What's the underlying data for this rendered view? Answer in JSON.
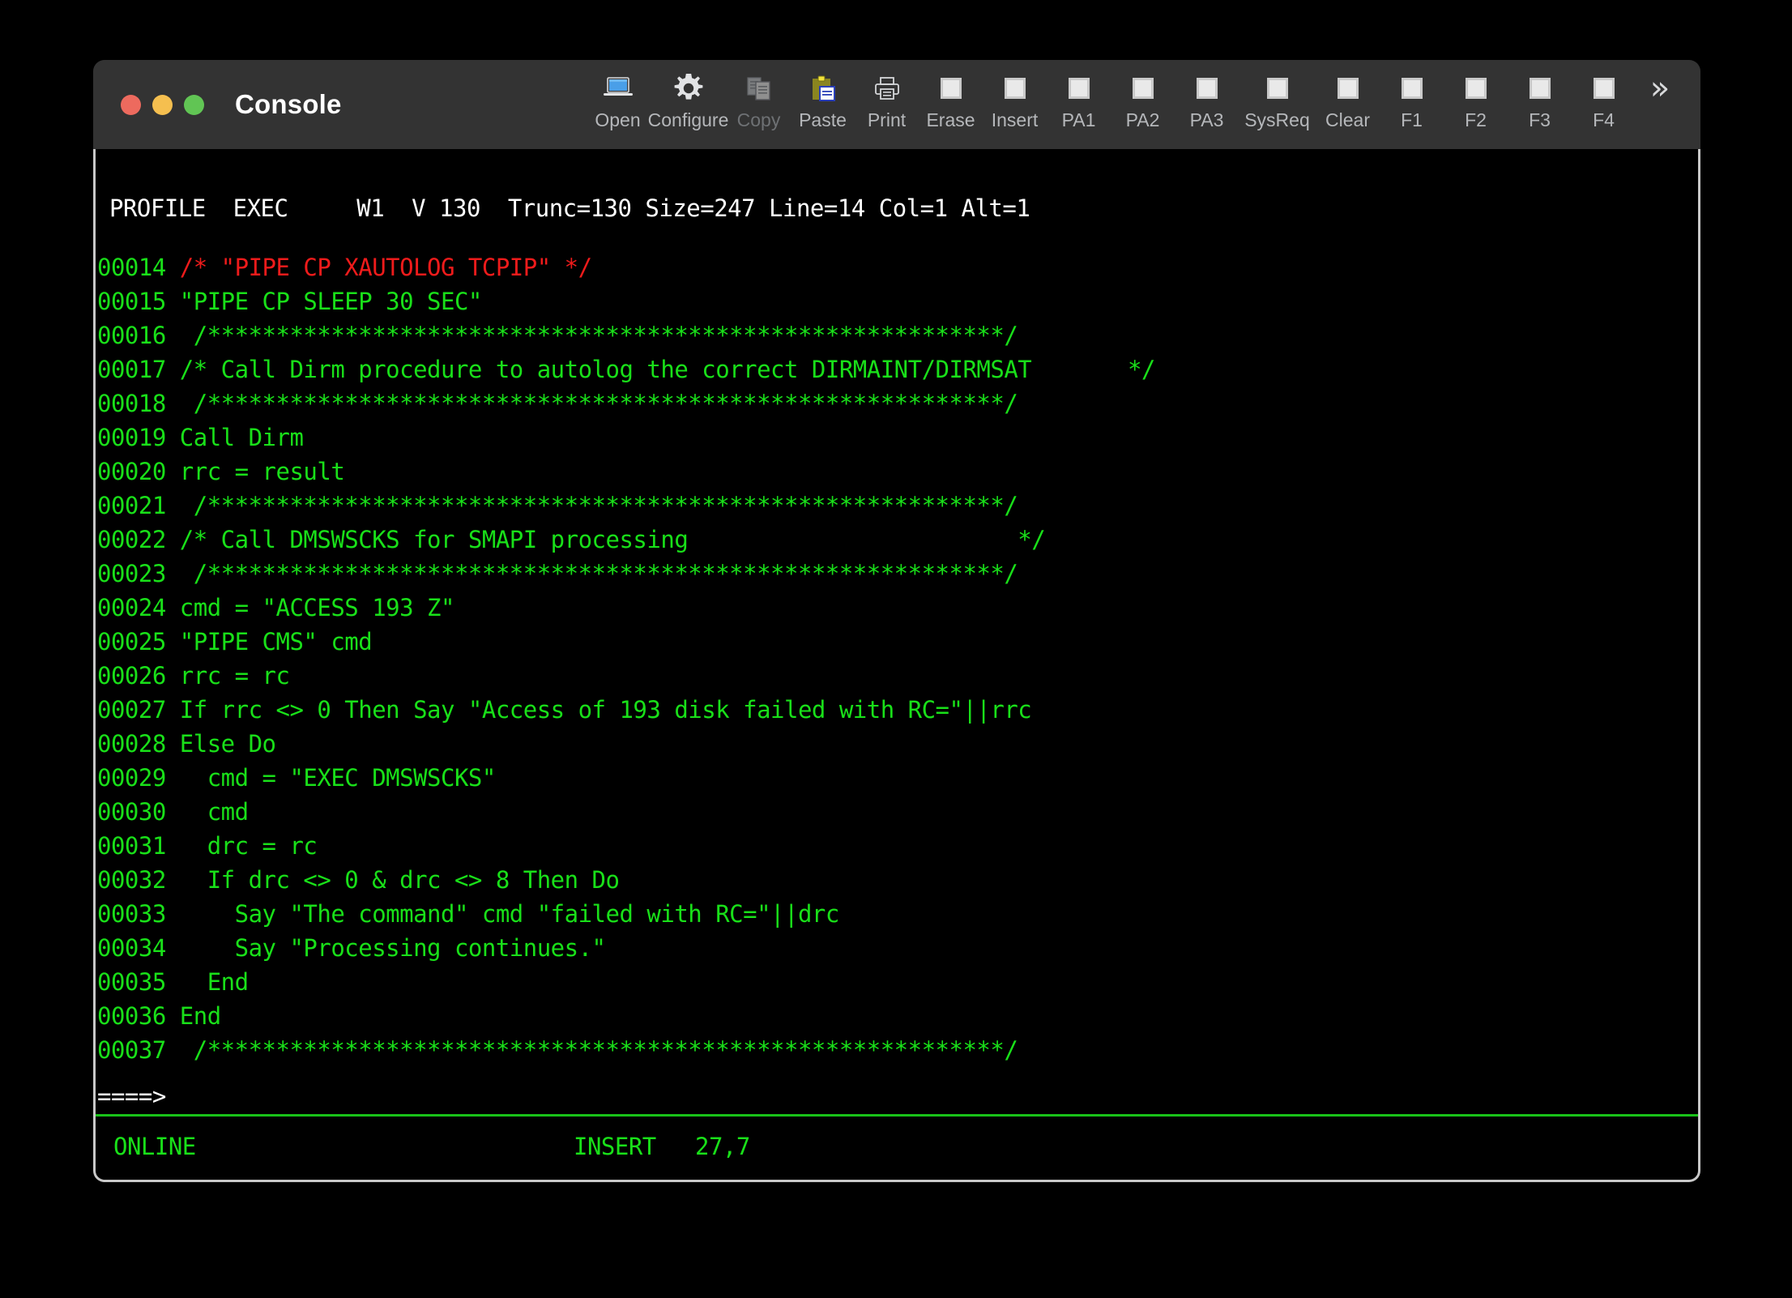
{
  "window": {
    "title": "Console",
    "traffic_lights": [
      {
        "name": "close",
        "color": "#ed6a5e"
      },
      {
        "name": "minimize",
        "color": "#f5bf4f"
      },
      {
        "name": "maximize",
        "color": "#61c554"
      }
    ]
  },
  "toolbar": {
    "overflow_glyph": "»",
    "items": [
      {
        "label": "Open",
        "icon": "laptop-icon",
        "disabled": false,
        "wide": false
      },
      {
        "label": "Configure",
        "icon": "gear-icon",
        "disabled": false,
        "wide": true
      },
      {
        "label": "Copy",
        "icon": "copy-icon",
        "disabled": true,
        "wide": false
      },
      {
        "label": "Paste",
        "icon": "clipboard-paste-icon",
        "disabled": false,
        "wide": false
      },
      {
        "label": "Print",
        "icon": "printer-icon",
        "disabled": false,
        "wide": false
      },
      {
        "label": "Erase",
        "icon": "square-key-icon",
        "disabled": false,
        "wide": false
      },
      {
        "label": "Insert",
        "icon": "square-key-icon",
        "disabled": false,
        "wide": false
      },
      {
        "label": "PA1",
        "icon": "square-key-icon",
        "disabled": false,
        "wide": false
      },
      {
        "label": "PA2",
        "icon": "square-key-icon",
        "disabled": false,
        "wide": false
      },
      {
        "label": "PA3",
        "icon": "square-key-icon",
        "disabled": false,
        "wide": false
      },
      {
        "label": "SysReq",
        "icon": "square-key-icon",
        "disabled": false,
        "wide": true
      },
      {
        "label": "Clear",
        "icon": "square-key-icon",
        "disabled": false,
        "wide": false
      },
      {
        "label": "F1",
        "icon": "square-key-icon",
        "disabled": false,
        "wide": false
      },
      {
        "label": "F2",
        "icon": "square-key-icon",
        "disabled": false,
        "wide": false
      },
      {
        "label": "F3",
        "icon": "square-key-icon",
        "disabled": false,
        "wide": false
      },
      {
        "label": "F4",
        "icon": "square-key-icon",
        "disabled": false,
        "wide": false
      }
    ]
  },
  "terminal": {
    "status_line": "PROFILE  EXEC     W1  V 130  Trunc=130 Size=247 Line=14 Col=1 Alt=1",
    "command_prompt": "====>",
    "lines": [
      {
        "num": "00014",
        "text": " /* \"PIPE CP XAUTOLOG TCPIP\" */",
        "color": "#ef1b1b"
      },
      {
        "num": "00015",
        "text": " \"PIPE CP SLEEP 30 SEC\"",
        "color": "#19e019"
      },
      {
        "num": "00016",
        "text": "  /**********************************************************/",
        "color": "#19e019"
      },
      {
        "num": "00017",
        "text": " /* Call Dirm procedure to autolog the correct DIRMAINT/DIRMSAT       */",
        "color": "#19e019"
      },
      {
        "num": "00018",
        "text": "  /**********************************************************/",
        "color": "#19e019"
      },
      {
        "num": "00019",
        "text": " Call Dirm",
        "color": "#19e019"
      },
      {
        "num": "00020",
        "text": " rrc = result",
        "color": "#19e019"
      },
      {
        "num": "00021",
        "text": "  /**********************************************************/",
        "color": "#19e019"
      },
      {
        "num": "00022",
        "text": " /* Call DMSWSCKS for SMAPI processing                        */",
        "color": "#19e019"
      },
      {
        "num": "00023",
        "text": "  /**********************************************************/",
        "color": "#19e019"
      },
      {
        "num": "00024",
        "text": " cmd = \"ACCESS 193 Z\"",
        "color": "#19e019"
      },
      {
        "num": "00025",
        "text": " \"PIPE CMS\" cmd",
        "color": "#19e019"
      },
      {
        "num": "00026",
        "text": " rrc = rc",
        "color": "#19e019"
      },
      {
        "num": "00027",
        "text": " If rrc <> 0 Then Say \"Access of 193 disk failed with RC=\"||rrc",
        "color": "#19e019"
      },
      {
        "num": "00028",
        "text": " Else Do",
        "color": "#19e019"
      },
      {
        "num": "00029",
        "text": "   cmd = \"EXEC DMSWSCKS\"",
        "color": "#19e019"
      },
      {
        "num": "00030",
        "text": "   cmd",
        "color": "#19e019"
      },
      {
        "num": "00031",
        "text": "   drc = rc",
        "color": "#19e019"
      },
      {
        "num": "00032",
        "text": "   If drc <> 0 & drc <> 8 Then Do",
        "color": "#19e019"
      },
      {
        "num": "00033",
        "text": "     Say \"The command\" cmd \"failed with RC=\"||drc",
        "color": "#19e019"
      },
      {
        "num": "00034",
        "text": "     Say \"Processing continues.\"",
        "color": "#19e019"
      },
      {
        "num": "00035",
        "text": "   End",
        "color": "#19e019"
      },
      {
        "num": "00036",
        "text": " End",
        "color": "#19e019"
      },
      {
        "num": "00037",
        "text": "  /**********************************************************/",
        "color": "#19e019"
      }
    ]
  },
  "footer": {
    "connection_status": "ONLINE",
    "insert_mode": "INSERT",
    "cursor_position": "27,7"
  },
  "colors": {
    "titlebar_bg": "#333333",
    "terminal_bg": "#000000",
    "terminal_green": "#19e019",
    "terminal_red": "#ef1b1b",
    "terminal_white": "#ffffff",
    "window_border": "#c8c8c8"
  }
}
